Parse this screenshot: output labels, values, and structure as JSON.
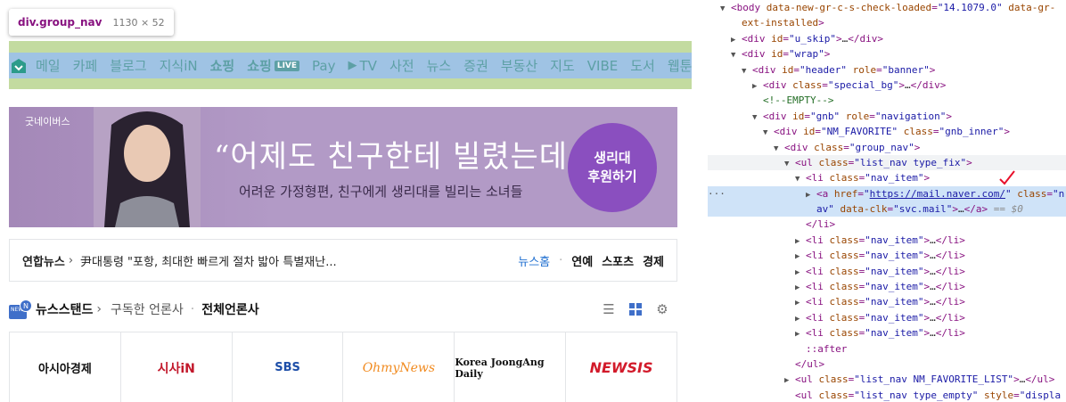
{
  "tooltip": {
    "tag": "div.group_nav",
    "dims": "1130 × 52"
  },
  "nav": {
    "items": [
      {
        "label": "메일"
      },
      {
        "label": "카페"
      },
      {
        "label": "블로그"
      },
      {
        "label": "지식iN"
      },
      {
        "label": "쇼핑"
      },
      {
        "label": "쇼핑",
        "badge": "LIVE"
      },
      {
        "label": "Pay"
      },
      {
        "label": "TV"
      },
      {
        "label": "사전"
      },
      {
        "label": "뉴스"
      },
      {
        "label": "증권"
      },
      {
        "label": "부동산"
      },
      {
        "label": "지도"
      },
      {
        "label": "VIBE"
      },
      {
        "label": "도서"
      },
      {
        "label": "웹툰"
      }
    ]
  },
  "banner": {
    "brand": "굿네이버스",
    "headline": "“어제도 친구한테 빌렸는데...”",
    "subline": "어려운 가정형편, 친구에게 생리대를 빌리는 소녀들",
    "cta_line1": "생리대",
    "cta_line2": "후원하기"
  },
  "newsbar": {
    "source": "연합뉴스",
    "headline": "尹대통령 \"포항, 최대한 빠르게 절차 밟아 특별재난...",
    "home": "뉴스홈",
    "links": [
      "연예",
      "스포츠",
      "경제"
    ]
  },
  "newsstand": {
    "badge": "N",
    "title": "뉴스스탠드",
    "subscribed": "구독한 언론사",
    "all": "전체언론사",
    "tools": [
      "list-icon",
      "grid-icon",
      "gear-icon"
    ]
  },
  "press": [
    "아시아경제",
    "시사iN",
    "SBS",
    "OhmyNews",
    "Korea JoongAng Daily",
    "NEWSIS"
  ],
  "dom": {
    "rows": [
      {
        "indent": 0,
        "tw": "▼",
        "parts": [
          [
            "t",
            "<body "
          ],
          [
            "a",
            "data-new-gr-c-s-check-loaded"
          ],
          [
            "t",
            "="
          ],
          [
            "v",
            "\"14.1079.0\""
          ],
          [
            "t",
            " "
          ],
          [
            "a",
            "data-gr-"
          ]
        ]
      },
      {
        "indent": 1,
        "tw": "",
        "parts": [
          [
            "a",
            "ext-installed"
          ],
          [
            "t",
            ">"
          ]
        ]
      },
      {
        "indent": 1,
        "tw": "▶",
        "parts": [
          [
            "t",
            "<div "
          ],
          [
            "a",
            "id"
          ],
          [
            "t",
            "="
          ],
          [
            "v",
            "\"u_skip\""
          ],
          [
            "t",
            ">"
          ],
          [
            "x",
            "…"
          ],
          [
            "t",
            "</div>"
          ]
        ]
      },
      {
        "indent": 1,
        "tw": "▼",
        "parts": [
          [
            "t",
            "<div "
          ],
          [
            "a",
            "id"
          ],
          [
            "t",
            "="
          ],
          [
            "v",
            "\"wrap\""
          ],
          [
            "t",
            ">"
          ]
        ]
      },
      {
        "indent": 2,
        "tw": "▼",
        "parts": [
          [
            "t",
            "<div "
          ],
          [
            "a",
            "id"
          ],
          [
            "t",
            "="
          ],
          [
            "v",
            "\"header\""
          ],
          [
            "t",
            " "
          ],
          [
            "a",
            "role"
          ],
          [
            "t",
            "="
          ],
          [
            "v",
            "\"banner\""
          ],
          [
            "t",
            ">"
          ]
        ]
      },
      {
        "indent": 3,
        "tw": "▶",
        "parts": [
          [
            "t",
            "<div "
          ],
          [
            "a",
            "class"
          ],
          [
            "t",
            "="
          ],
          [
            "v",
            "\"special_bg\""
          ],
          [
            "t",
            ">"
          ],
          [
            "x",
            "…"
          ],
          [
            "t",
            "</div>"
          ]
        ]
      },
      {
        "indent": 3,
        "tw": "",
        "parts": [
          [
            "c",
            "<!--EMPTY-->"
          ]
        ]
      },
      {
        "indent": 3,
        "tw": "▼",
        "parts": [
          [
            "t",
            "<div "
          ],
          [
            "a",
            "id"
          ],
          [
            "t",
            "="
          ],
          [
            "v",
            "\"gnb\""
          ],
          [
            "t",
            " "
          ],
          [
            "a",
            "role"
          ],
          [
            "t",
            "="
          ],
          [
            "v",
            "\"navigation\""
          ],
          [
            "t",
            ">"
          ]
        ]
      },
      {
        "indent": 4,
        "tw": "▼",
        "parts": [
          [
            "t",
            "<div "
          ],
          [
            "a",
            "id"
          ],
          [
            "t",
            "="
          ],
          [
            "v",
            "\"NM_FAVORITE\""
          ],
          [
            "t",
            " "
          ],
          [
            "a",
            "class"
          ],
          [
            "t",
            "="
          ],
          [
            "v",
            "\"gnb_inner\""
          ],
          [
            "t",
            ">"
          ]
        ]
      },
      {
        "indent": 5,
        "tw": "▼",
        "parts": [
          [
            "t",
            "<div "
          ],
          [
            "a",
            "class"
          ],
          [
            "t",
            "="
          ],
          [
            "v",
            "\"group_nav\""
          ],
          [
            "t",
            ">"
          ]
        ]
      },
      {
        "indent": 6,
        "tw": "▼",
        "hover": true,
        "parts": [
          [
            "t",
            "<ul "
          ],
          [
            "a",
            "class"
          ],
          [
            "t",
            "="
          ],
          [
            "v",
            "\"list_nav type_fix\""
          ],
          [
            "t",
            ">"
          ]
        ]
      },
      {
        "indent": 7,
        "tw": "▼",
        "parts": [
          [
            "t",
            "<li "
          ],
          [
            "a",
            "class"
          ],
          [
            "t",
            "="
          ],
          [
            "v",
            "\"nav_item\""
          ],
          [
            "t",
            ">"
          ]
        ]
      },
      {
        "indent": 8,
        "tw": "▶",
        "sel": true,
        "parts": [
          [
            "t",
            "<a "
          ],
          [
            "a",
            "href"
          ],
          [
            "t",
            "="
          ],
          [
            "v",
            "\""
          ],
          [
            "l",
            "https://mail.naver.com/"
          ],
          [
            "v",
            "\""
          ],
          [
            "t",
            " "
          ],
          [
            "a",
            "class"
          ],
          [
            "t",
            "="
          ],
          [
            "v",
            "\"n"
          ]
        ]
      },
      {
        "indent": 8,
        "tw": "",
        "sel": true,
        "parts": [
          [
            "v",
            "av\""
          ],
          [
            "t",
            " "
          ],
          [
            "a",
            "data-clk"
          ],
          [
            "t",
            "="
          ],
          [
            "v",
            "\"svc.mail\""
          ],
          [
            "t",
            ">"
          ],
          [
            "x",
            "…"
          ],
          [
            "t",
            "</a>"
          ],
          [
            "e",
            " == $0"
          ]
        ]
      },
      {
        "indent": 7,
        "tw": "",
        "parts": [
          [
            "t",
            "</li>"
          ]
        ]
      },
      {
        "indent": 7,
        "tw": "▶",
        "parts": [
          [
            "t",
            "<li "
          ],
          [
            "a",
            "class"
          ],
          [
            "t",
            "="
          ],
          [
            "v",
            "\"nav_item\""
          ],
          [
            "t",
            ">"
          ],
          [
            "x",
            "…"
          ],
          [
            "t",
            "</li>"
          ]
        ]
      },
      {
        "indent": 7,
        "tw": "▶",
        "parts": [
          [
            "t",
            "<li "
          ],
          [
            "a",
            "class"
          ],
          [
            "t",
            "="
          ],
          [
            "v",
            "\"nav_item\""
          ],
          [
            "t",
            ">"
          ],
          [
            "x",
            "…"
          ],
          [
            "t",
            "</li>"
          ]
        ]
      },
      {
        "indent": 7,
        "tw": "▶",
        "parts": [
          [
            "t",
            "<li "
          ],
          [
            "a",
            "class"
          ],
          [
            "t",
            "="
          ],
          [
            "v",
            "\"nav_item\""
          ],
          [
            "t",
            ">"
          ],
          [
            "x",
            "…"
          ],
          [
            "t",
            "</li>"
          ]
        ]
      },
      {
        "indent": 7,
        "tw": "▶",
        "parts": [
          [
            "t",
            "<li "
          ],
          [
            "a",
            "class"
          ],
          [
            "t",
            "="
          ],
          [
            "v",
            "\"nav_item\""
          ],
          [
            "t",
            ">"
          ],
          [
            "x",
            "…"
          ],
          [
            "t",
            "</li>"
          ]
        ]
      },
      {
        "indent": 7,
        "tw": "▶",
        "parts": [
          [
            "t",
            "<li "
          ],
          [
            "a",
            "class"
          ],
          [
            "t",
            "="
          ],
          [
            "v",
            "\"nav_item\""
          ],
          [
            "t",
            ">"
          ],
          [
            "x",
            "…"
          ],
          [
            "t",
            "</li>"
          ]
        ]
      },
      {
        "indent": 7,
        "tw": "▶",
        "parts": [
          [
            "t",
            "<li "
          ],
          [
            "a",
            "class"
          ],
          [
            "t",
            "="
          ],
          [
            "v",
            "\"nav_item\""
          ],
          [
            "t",
            ">"
          ],
          [
            "x",
            "…"
          ],
          [
            "t",
            "</li>"
          ]
        ]
      },
      {
        "indent": 7,
        "tw": "▶",
        "parts": [
          [
            "t",
            "<li "
          ],
          [
            "a",
            "class"
          ],
          [
            "t",
            "="
          ],
          [
            "v",
            "\"nav_item\""
          ],
          [
            "t",
            ">"
          ],
          [
            "x",
            "…"
          ],
          [
            "t",
            "</li>"
          ]
        ]
      },
      {
        "indent": 7,
        "tw": "",
        "parts": [
          [
            "p",
            "::after"
          ]
        ]
      },
      {
        "indent": 6,
        "tw": "",
        "parts": [
          [
            "t",
            "</ul>"
          ]
        ]
      },
      {
        "indent": 6,
        "tw": "▶",
        "parts": [
          [
            "t",
            "<ul "
          ],
          [
            "a",
            "class"
          ],
          [
            "t",
            "="
          ],
          [
            "v",
            "\"list_nav NM_FAVORITE_LIST\""
          ],
          [
            "t",
            ">"
          ],
          [
            "x",
            "…"
          ],
          [
            "t",
            "</ul>"
          ]
        ]
      },
      {
        "indent": 6,
        "tw": "",
        "parts": [
          [
            "t",
            "<ul "
          ],
          [
            "a",
            "class"
          ],
          [
            "t",
            "="
          ],
          [
            "v",
            "\"list_nav type_empty\""
          ],
          [
            "t",
            " "
          ],
          [
            "a",
            "style"
          ],
          [
            "t",
            "="
          ],
          [
            "v",
            "\"displa"
          ]
        ]
      }
    ]
  },
  "colors": {
    "nav_text": "#5da0a5",
    "highlight_margin": "#c3dba0",
    "highlight_content": "#9fc3e4",
    "selected_row": "#cfe3f8"
  }
}
